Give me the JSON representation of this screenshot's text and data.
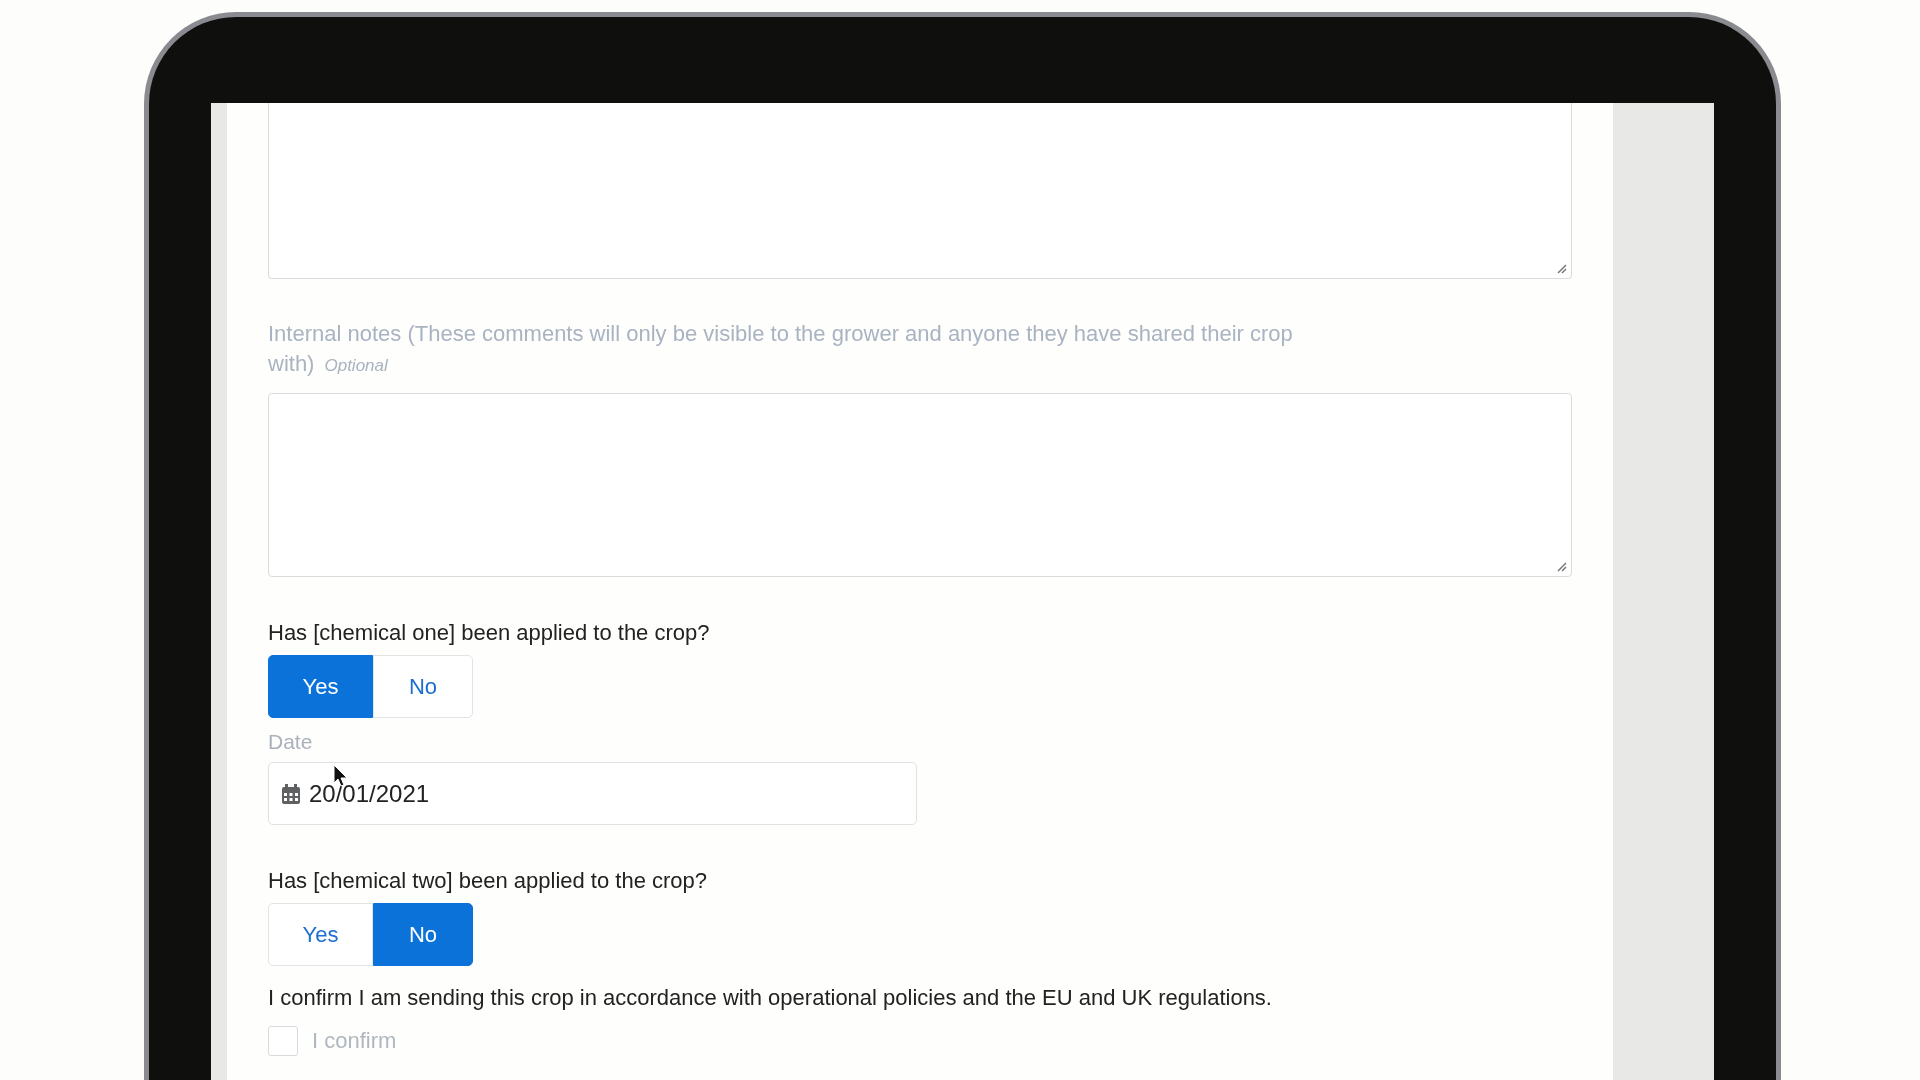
{
  "fields": [
    {
      "kind": "textarea"
    },
    {
      "kind": "textarea",
      "label": "Internal notes (These comments will only be visible to the grower and anyone they have shared their crop with)",
      "optional": "Optional"
    },
    {
      "kind": "toggle",
      "question": "Has [chemical one] been applied to the crop?",
      "options": [
        {
          "label": "Yes",
          "selected": true
        },
        {
          "label": "No",
          "selected": false
        }
      ]
    },
    {
      "kind": "date",
      "label": "Date",
      "value": "20/01/2021"
    },
    {
      "kind": "toggle",
      "question": "Has [chemical two] been applied to the crop?",
      "options": [
        {
          "label": "Yes",
          "selected": false
        },
        {
          "label": "No",
          "selected": true
        }
      ]
    },
    {
      "kind": "checkbox",
      "question": "I confirm I am sending this crop in accordance with operational policies and the EU and UK regulations.",
      "label": "I confirm",
      "checked": false
    }
  ]
}
